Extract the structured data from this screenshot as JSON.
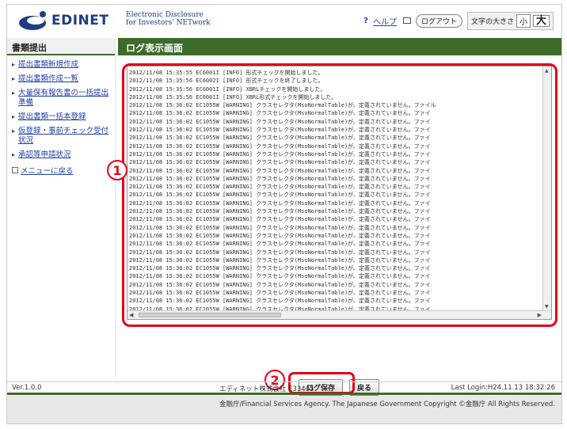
{
  "header": {
    "logo_text": "EDINET",
    "logo_sub_line1": "Electronic Disclosure",
    "logo_sub_line2": "for Investors' NETwork",
    "help_mark": "?",
    "help_label": "ヘルプ",
    "logout_label": "ログアウト",
    "fontsize_label": "文字の大きさ",
    "font_small": "小",
    "font_large": "大"
  },
  "sidebar": {
    "heading": "書類提出",
    "items": [
      {
        "label": "提出書類新規作成"
      },
      {
        "label": "提出書類作成一覧"
      },
      {
        "label": "大量保有報告書の一括提出準備"
      },
      {
        "label": "提出書類一括本登録"
      },
      {
        "label": "仮登録・事前チェック受付状況"
      },
      {
        "label": "承認等申請状況"
      }
    ],
    "back_to_menu": "メニューに戻る"
  },
  "main": {
    "title": "ログ表示画面",
    "log_lines": [
      "2012/11/08 15:35:55 EC6001I [INFO] 形式チェックを開始しました。",
      "2012/11/08 15:35:56 EC6002I [INFO] 形式チェックを終了しました。",
      "2012/11/08 15:35:56 EC6001I [INFO] XBRLチェックを開始しました。",
      "2012/11/08 15:35:56 EC6001I [INFO] XBRL形式チェックを開始しました。",
      "2012/11/08 15:36:02 EC1055W [WARNING] クラスセレクタ(MsoNormalTable)が、定義されていません。ファイル",
      "2012/11/08 15:36:02 EC1055W [WARNING] クラスセレクタ(MsoNormalTable)が、定義されていません。ファイ",
      "2012/11/08 15:36:02 EC1055W [WARNING] クラスセレクタ(MsoNormalTable)が、定義されていません。ファイ",
      "2012/11/08 15:36:02 EC1055W [WARNING] クラスセレクタ(MsoNormalTable)が、定義されていません。ファイ",
      "2012/11/08 15:36:02 EC1055W [WARNING] クラスセレクタ(MsoNormalTable)が、定義されていません。ファイ",
      "2012/11/08 15:36:02 EC1055W [WARNING] クラスセレクタ(MsoNormalTable)が、定義されていません。ファイ",
      "2012/11/08 15:36:02 EC1055W [WARNING] クラスセレクタ(MsoNormalTable)が、定義されていません。ファイ",
      "2012/11/08 15:36:02 EC1055W [WARNING] クラスセレクタ(MsoNormalTable)が、定義されていません。ファイ",
      "2012/11/08 15:36:02 EC1055W [WARNING] クラスセレクタ(MsoNormalTable)が、定義されていません。ファイ",
      "2012/11/08 15:36:02 EC1055W [WARNING] クラスセレクタ(MsoNormalTable)が、定義されていません。ファイ",
      "2012/11/08 15:36:02 EC1055W [WARNING] クラスセレクタ(MsoNormalTable)が、定義されていません。ファイ",
      "2012/11/08 15:36:02 EC1055W [WARNING] クラスセレクタ(MsoNormalTable)が、定義されていません。ファイ",
      "2012/11/08 15:36:02 EC1055W [WARNING] クラスセレクタ(MsoNormalTable)が、定義されていません。ファイ",
      "2012/11/08 15:36:02 EC1055W [WARNING] クラスセレクタ(MsoNormalTable)が、定義されていません。ファイ",
      "2012/11/08 15:36:02 EC1055W [WARNING] クラスセレクタ(MsoNormalTable)が、定義されていません。ファイ",
      "2012/11/08 15:36:02 EC1055W [WARNING] クラスセレクタ(MsoNormalTable)が、定義されていません。ファイ",
      "2012/11/08 15:36:02 EC1055W [WARNING] クラスセレクタ(MsoNormalTable)が、定義されていません。ファイ",
      "2012/11/08 15:36:02 EC1055W [WARNING] クラスセレクタ(MsoNormalTable)が、定義されていません。ファイ",
      "2012/11/08 15:36:02 EC1055W [WARNING] クラスセレクタ(MsoNormalTable)が、定義されていません。ファイ",
      "2012/11/08 15:36:02 EC1055W [WARNING] クラスセレクタ(MsoNormalTable)が、定義されていません。ファイ",
      "2012/11/08 15:36:02 EC1055W [WARNING] クラスセレクタ(MsoNormalTable)が、定義されていません。ファイ",
      "2012/11/08 15:36:02 EC1055W [WARNING] クラスセレクタ(MsoNormalTable)が、定義されていません。ファイ",
      "2012/11/08 15:36:02 EC1055W [WARNING] クラスセレクタ(MsoNormalTable)が、定義されていません。ファイ",
      "2012/11/08 15:36:02 EC1055W [WARNING] クラスセレクタ(MsoNormalTable)が、定義されていません。ファイ",
      "2012/11/08 15:36:02 EC1055W [WARNING] クラスセレクタ(MsoNormalTable)が、定義されていません。ファイ",
      "2012/11/08 15:36:02 EC1055W [WARNING] クラスセレクタ(MsoNormalTable)が、定義されていません。ファイ"
    ],
    "save_button": "ログ保存",
    "back_button": "戻る"
  },
  "annotations": {
    "marker_1": "1",
    "marker_2": "2",
    "color": "#e3001b"
  },
  "footer": {
    "version": "Ver.1.0.0",
    "company": "エディネット株式会社 E33405",
    "last_login": "Last Login:H24.11.13 18:32:26",
    "copyright": "金融庁/Financial Services Agency. The Japanese Government Copyright ©金融庁 All Rights Reserved."
  },
  "colors": {
    "brand_blue": "#1d3e84",
    "header_green": "#3d6b29",
    "link_blue": "#2140a6"
  }
}
